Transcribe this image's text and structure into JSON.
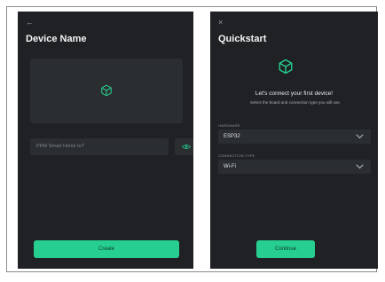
{
  "left_screen": {
    "back_glyph": "←",
    "title": "Device Name",
    "name_input": {
      "value": "PRM Smart Home IoT"
    },
    "create_label": "Create"
  },
  "right_screen": {
    "close_glyph": "×",
    "title": "Quickstart",
    "heading": "Let's connect your first device!",
    "subtitle": "Select the board and connection type you will use.",
    "hardware": {
      "label": "HARDWARE",
      "value": "ESP32"
    },
    "connection": {
      "label": "CONNECTION TYPE",
      "value": "Wi-Fi"
    },
    "continue_label": "Continue"
  },
  "icons": {
    "cube": "cube-icon",
    "eye": "eye-icon",
    "chevron": "chevron-down-icon"
  },
  "colors": {
    "accent": "#26cf8f",
    "panel": "#1f2124",
    "field": "#2b2e31"
  }
}
